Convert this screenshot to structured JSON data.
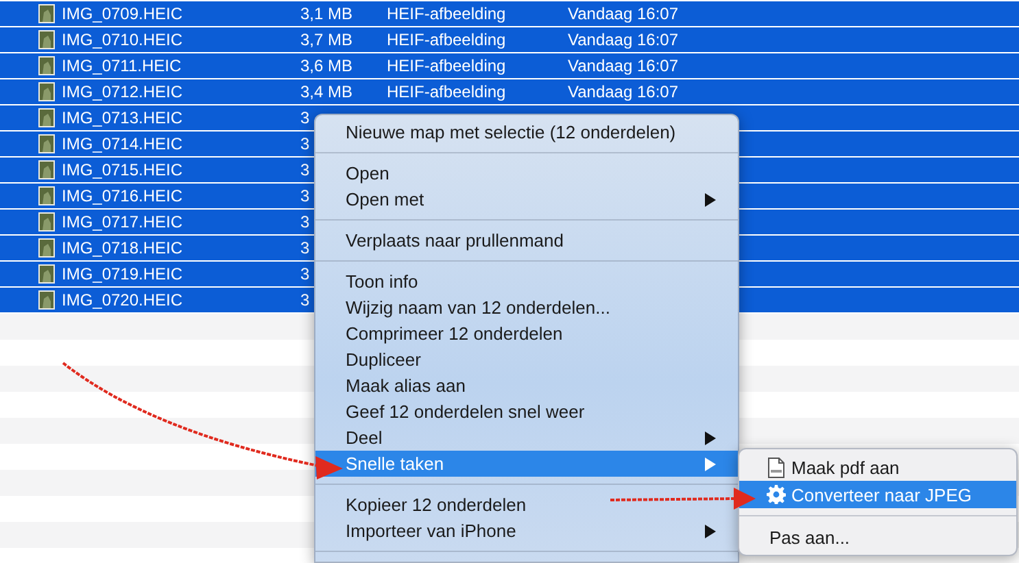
{
  "files": [
    {
      "name": "IMG_0709.HEIC",
      "size": "3,1 MB",
      "kind": "HEIF-afbeelding",
      "modified": "Vandaag 16:07",
      "selected": true
    },
    {
      "name": "IMG_0710.HEIC",
      "size": "3,7 MB",
      "kind": "HEIF-afbeelding",
      "modified": "Vandaag 16:07",
      "selected": true
    },
    {
      "name": "IMG_0711.HEIC",
      "size": "3,6 MB",
      "kind": "HEIF-afbeelding",
      "modified": "Vandaag 16:07",
      "selected": true
    },
    {
      "name": "IMG_0712.HEIC",
      "size": "3,4 MB",
      "kind": "HEIF-afbeelding",
      "modified": "Vandaag 16:07",
      "selected": true
    },
    {
      "name": "IMG_0713.HEIC",
      "size": "3",
      "selected": true
    },
    {
      "name": "IMG_0714.HEIC",
      "size": "3",
      "selected": true
    },
    {
      "name": "IMG_0715.HEIC",
      "size": "3",
      "selected": true
    },
    {
      "name": "IMG_0716.HEIC",
      "size": "3",
      "selected": true
    },
    {
      "name": "IMG_0717.HEIC",
      "size": "3",
      "selected": true
    },
    {
      "name": "IMG_0718.HEIC",
      "size": "3",
      "selected": true
    },
    {
      "name": "IMG_0719.HEIC",
      "size": "3",
      "selected": true
    },
    {
      "name": "IMG_0720.HEIC",
      "size": "3",
      "selected": true
    }
  ],
  "context_menu": {
    "items": [
      {
        "kind": "item",
        "label": "Nieuwe map met selectie (12 onderdelen)",
        "submenu": false,
        "selected": false
      },
      {
        "kind": "separator"
      },
      {
        "kind": "item",
        "label": "Open",
        "submenu": false,
        "selected": false
      },
      {
        "kind": "item",
        "label": "Open met",
        "submenu": true,
        "selected": false
      },
      {
        "kind": "separator"
      },
      {
        "kind": "item",
        "label": "Verplaats naar prullenmand",
        "submenu": false,
        "selected": false
      },
      {
        "kind": "separator"
      },
      {
        "kind": "item",
        "label": "Toon info",
        "submenu": false,
        "selected": false
      },
      {
        "kind": "item",
        "label": "Wijzig naam van 12 onderdelen...",
        "submenu": false,
        "selected": false
      },
      {
        "kind": "item",
        "label": "Comprimeer 12 onderdelen",
        "submenu": false,
        "selected": false
      },
      {
        "kind": "item",
        "label": "Dupliceer",
        "submenu": false,
        "selected": false
      },
      {
        "kind": "item",
        "label": "Maak alias aan",
        "submenu": false,
        "selected": false
      },
      {
        "kind": "item",
        "label": "Geef 12 onderdelen snel weer",
        "submenu": false,
        "selected": false
      },
      {
        "kind": "item",
        "label": "Deel",
        "submenu": true,
        "selected": false
      },
      {
        "kind": "item",
        "label": "Snelle taken",
        "submenu": true,
        "selected": true
      },
      {
        "kind": "separator"
      },
      {
        "kind": "item",
        "label": "Kopieer 12 onderdelen",
        "submenu": false,
        "selected": false
      },
      {
        "kind": "item",
        "label": "Importeer van iPhone",
        "submenu": true,
        "selected": false
      },
      {
        "kind": "separator"
      }
    ]
  },
  "submenu": {
    "items": [
      {
        "kind": "pdf",
        "label": "Maak pdf aan",
        "selected": false
      },
      {
        "kind": "workflow",
        "label": "Converteer naar JPEG",
        "selected": true
      },
      {
        "kind": "separator"
      },
      {
        "kind": "item",
        "label": "Pas aan...",
        "selected": false
      }
    ]
  }
}
